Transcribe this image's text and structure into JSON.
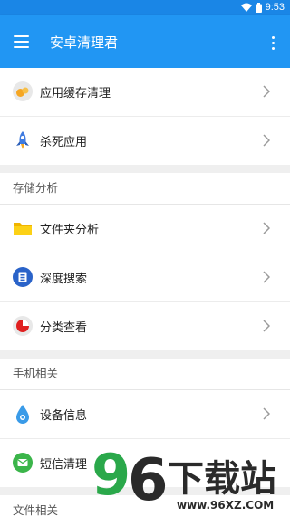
{
  "status": {
    "time": "9:53"
  },
  "header": {
    "title": "安卓清理君"
  },
  "groups": [
    {
      "title": "",
      "items": [
        {
          "label": "应用缓存清理",
          "icon": "cache-icon"
        },
        {
          "label": "杀死应用",
          "icon": "rocket-icon"
        }
      ]
    },
    {
      "title": "存储分析",
      "items": [
        {
          "label": "文件夹分析",
          "icon": "folder-icon"
        },
        {
          "label": "深度搜索",
          "icon": "search-icon"
        },
        {
          "label": "分类查看",
          "icon": "pie-chart-icon"
        }
      ]
    },
    {
      "title": "手机相关",
      "items": [
        {
          "label": "设备信息",
          "icon": "device-icon"
        },
        {
          "label": "短信清理",
          "icon": "message-icon"
        }
      ]
    },
    {
      "title": "文件相关",
      "items": []
    }
  ],
  "watermark": {
    "brand": "96下载站",
    "url": "www.96XZ.COM"
  },
  "colors": {
    "primary": "#2196f3",
    "statusbar": "#1a86e6",
    "background": "#efefef"
  }
}
